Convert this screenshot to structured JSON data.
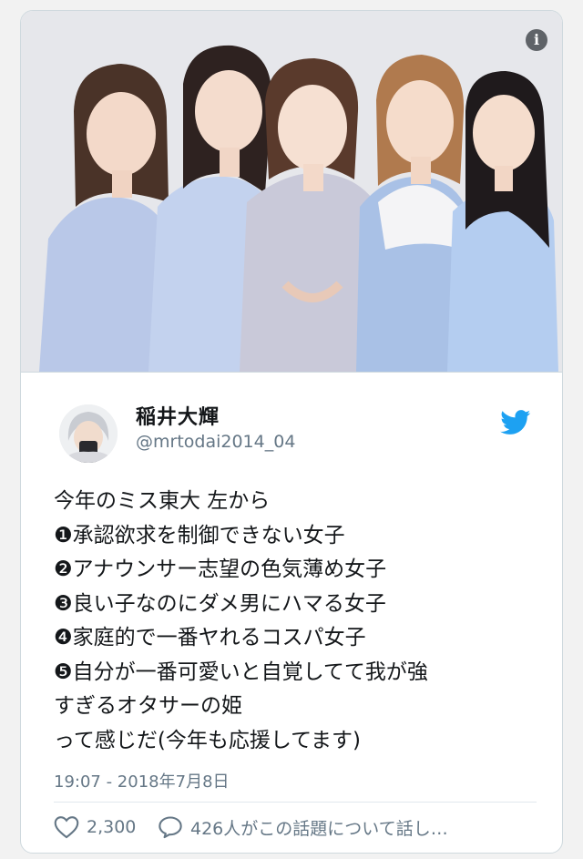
{
  "media": {
    "icon": "info-icon",
    "info_glyph": "i"
  },
  "author": {
    "name": "稲井大輝",
    "handle": "@mrtodai2014_04",
    "brand_icon": "twitter-bird-icon",
    "brand_color": "#1da1f2"
  },
  "tweet": {
    "lines": [
      "今年のミス東大 左から",
      "❶承認欲求を制御できない女子",
      "❷アナウンサー志望の色気薄め女子",
      "❸良い子なのにダメ男にハマる女子",
      "❹家庭的で一番ヤれるコスパ女子",
      "❺自分が一番可愛いと自覚してて我が強",
      "すぎるオタサーの姫",
      "って感じだ(今年も応援してます)"
    ],
    "timestamp": "19:07 - 2018年7月8日"
  },
  "actions": {
    "likes": "2,300",
    "like_icon": "heart-icon",
    "replies_text": "426人がこの話題について話し…",
    "reply_icon": "speech-bubble-icon"
  },
  "colors": {
    "text": "#14171a",
    "secondary": "#657786",
    "border": "#cfd9de"
  }
}
